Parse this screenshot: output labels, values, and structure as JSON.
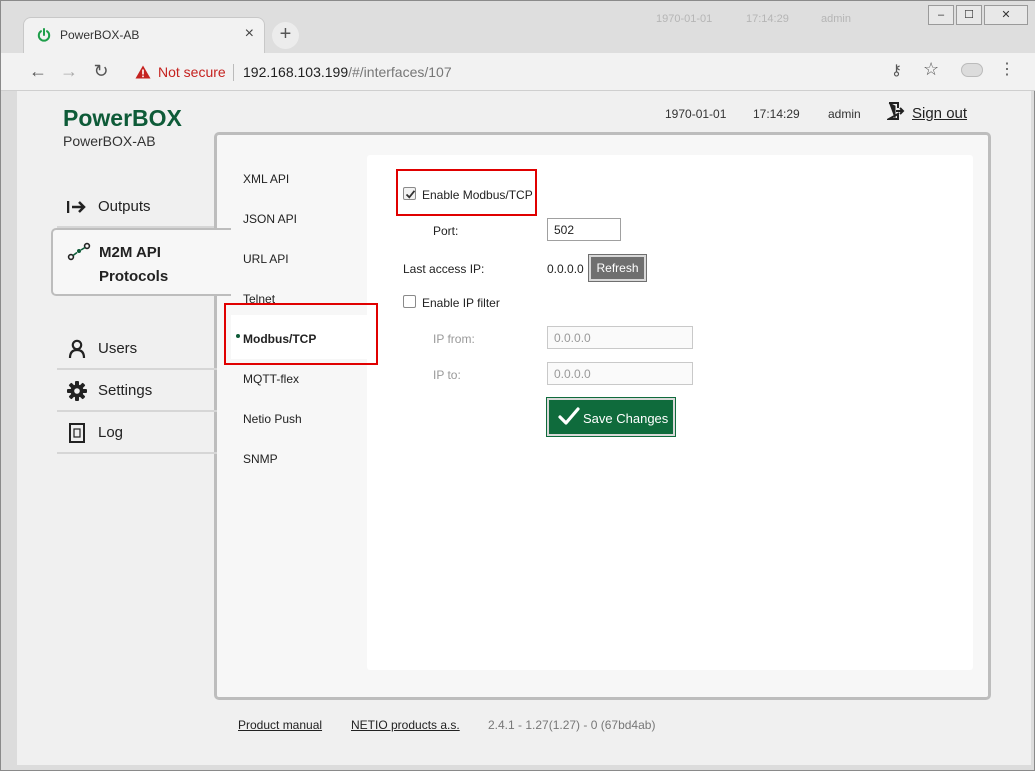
{
  "browser": {
    "tab_title": "PowerBOX-AB",
    "new_tab_symbol": "+",
    "ghost": {
      "date": "1970-01-01",
      "time": "17:14:29",
      "user": "admin"
    },
    "security_label": "Not secure",
    "url_host": "192.168.103.199",
    "url_path": "/#/interfaces/107",
    "window_buttons": [
      "–",
      "☐",
      "✕"
    ]
  },
  "header": {
    "brand": "PowerBOX",
    "device_name": "PowerBOX-AB",
    "date": "1970-01-01",
    "time": "17:14:29",
    "user": "admin",
    "sign_out": "Sign out"
  },
  "main_menu": {
    "outputs": "Outputs",
    "m2m_line1": "M2M API",
    "m2m_line2": "Protocols",
    "users": "Users",
    "settings": "Settings",
    "log": "Log"
  },
  "sub_menu": [
    "XML API",
    "JSON API",
    "URL API",
    "Telnet",
    "Modbus/TCP",
    "MQTT-flex",
    "Netio Push",
    "SNMP"
  ],
  "form": {
    "enable_label": "Enable Modbus/TCP",
    "enable_checked": true,
    "port_label": "Port:",
    "port_value": "502",
    "last_ip_label": "Last access IP:",
    "last_ip_value": "0.0.0.0",
    "refresh_label": "Refresh",
    "ip_filter_label": "Enable IP filter",
    "ip_filter_checked": false,
    "ip_from_label": "IP from:",
    "ip_from_value": "0.0.0.0",
    "ip_to_label": "IP to:",
    "ip_to_value": "0.0.0.0",
    "save_label": "Save Changes"
  },
  "footer": {
    "manual": "Product manual",
    "company": "NETIO products a.s.",
    "version": "2.4.1 - 1.27(1.27) - 0 (67bd4ab)"
  },
  "colors": {
    "brand_green": "#0e5b38",
    "save_green": "#0f6b3c",
    "highlight_red": "#e00000"
  }
}
